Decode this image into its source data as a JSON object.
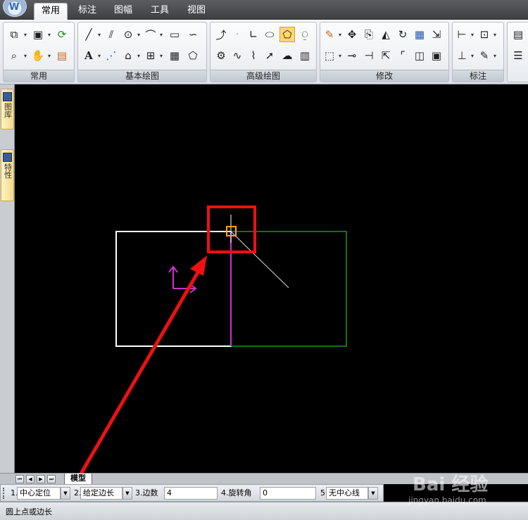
{
  "app": {
    "logo_letter": "W",
    "tabs": [
      {
        "label": "常用",
        "active": true
      },
      {
        "label": "标注",
        "active": false
      },
      {
        "label": "图幅",
        "active": false
      },
      {
        "label": "工具",
        "active": false
      },
      {
        "label": "视图",
        "active": false
      }
    ]
  },
  "ribbon": {
    "panels": [
      {
        "title": "常用"
      },
      {
        "title": "基本绘图"
      },
      {
        "title": "高级绘图"
      },
      {
        "title": "修改"
      },
      {
        "title": "标注"
      }
    ],
    "text_tool_glyph": "A"
  },
  "sidebar": {
    "tabs": [
      {
        "label": "图库",
        "icon": "library-icon"
      },
      {
        "label": "特性",
        "icon": "properties-icon"
      }
    ]
  },
  "layout_tabs": {
    "nav_buttons": [
      "first",
      "prev",
      "next",
      "last"
    ],
    "model_tab": "模型"
  },
  "command_bar": {
    "options": [
      {
        "index": "1.",
        "value": "中心定位",
        "kind": "dropdown"
      },
      {
        "index": "2.",
        "value": "给定边长",
        "kind": "dropdown"
      },
      {
        "index": "3.边数",
        "value": "4",
        "kind": "input"
      },
      {
        "index": "4.旋转角",
        "value": "0",
        "kind": "input"
      },
      {
        "index": "5.",
        "value": "无中心线",
        "kind": "dropdown"
      }
    ]
  },
  "status": {
    "prompt": "圆上点或边长"
  },
  "watermark": {
    "brand": "Bai 经验",
    "url": "jingyan.baidu.com"
  },
  "colors": {
    "canvas_bg": "#000000",
    "white_rect": "#ffffff",
    "green_rect": "#33dd33",
    "magenta": "#cc33cc",
    "annotation_red": "#ee1111",
    "cursor_orange": "#ffaa00"
  }
}
